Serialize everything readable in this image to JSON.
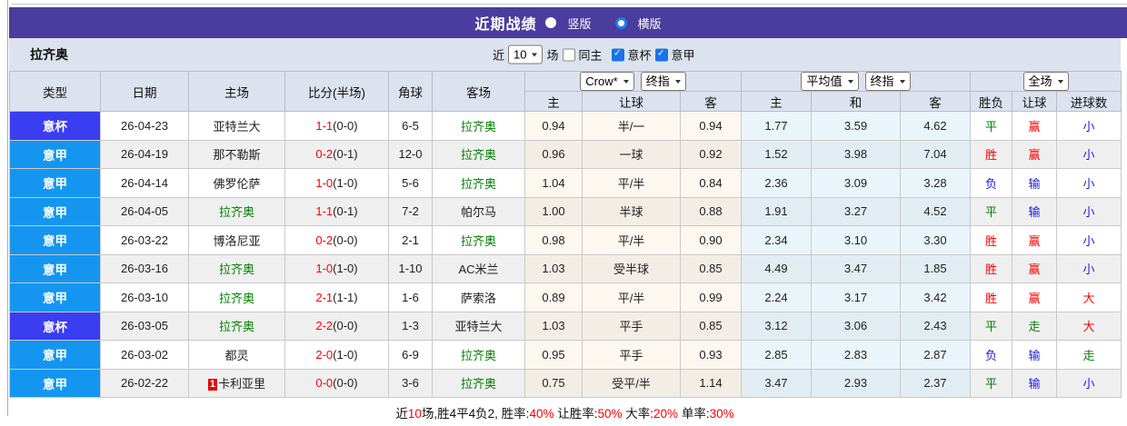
{
  "titlebar": {
    "title": "近期战绩",
    "vertical_label": "竖版",
    "horizontal_label": "横版"
  },
  "controls": {
    "team_name": "拉齐奥",
    "near_label": "近",
    "count_value": "10",
    "unit_label": "场",
    "same_home_label": "同主",
    "cup_filter_label": "意杯",
    "league_filter_label": "意甲",
    "same_home_checked": false,
    "cup_checked": true,
    "league_checked": true
  },
  "table": {
    "selects": {
      "asian_company": "Crow*",
      "asian_kind": "终指",
      "euro_company": "平均值",
      "euro_kind": "终指",
      "scope": "全场"
    },
    "headers": {
      "type": "类型",
      "date": "日期",
      "home": "主场",
      "score": "比分(半场)",
      "corners": "角球",
      "away": "客场",
      "sub": [
        "主",
        "让球",
        "客",
        "主",
        "和",
        "客",
        "胜负",
        "让球",
        "进球数"
      ]
    },
    "rows": [
      {
        "type": "意杯",
        "type_kind": "cup",
        "date": "26-04-23",
        "home": {
          "name": "亚特兰大",
          "lazio": false
        },
        "score": "1-1",
        "half": "(0-0)",
        "corners": "6-5",
        "away": {
          "name": "拉齐奥",
          "lazio": true
        },
        "asian": [
          "0.94",
          "半/一",
          "0.94"
        ],
        "euro": [
          "1.77",
          "3.59",
          "4.62"
        ],
        "result": {
          "t": "平",
          "c": "green"
        },
        "handicap": {
          "t": "赢",
          "c": "red"
        },
        "goals": {
          "t": "小",
          "c": "blue"
        }
      },
      {
        "type": "意甲",
        "type_kind": "league",
        "date": "26-04-19",
        "home": {
          "name": "那不勒斯",
          "lazio": false
        },
        "score": "0-2",
        "half": "(0-1)",
        "corners": "12-0",
        "away": {
          "name": "拉齐奥",
          "lazio": true
        },
        "asian": [
          "0.96",
          "一球",
          "0.92"
        ],
        "euro": [
          "1.52",
          "3.98",
          "7.04"
        ],
        "result": {
          "t": "胜",
          "c": "red"
        },
        "handicap": {
          "t": "赢",
          "c": "red"
        },
        "goals": {
          "t": "小",
          "c": "blue"
        }
      },
      {
        "type": "意甲",
        "type_kind": "league",
        "date": "26-04-14",
        "home": {
          "name": "佛罗伦萨",
          "lazio": false
        },
        "score": "1-0",
        "half": "(1-0)",
        "corners": "5-6",
        "away": {
          "name": "拉齐奥",
          "lazio": true
        },
        "asian": [
          "1.04",
          "平/半",
          "0.84"
        ],
        "euro": [
          "2.36",
          "3.09",
          "3.28"
        ],
        "result": {
          "t": "负",
          "c": "blue"
        },
        "handicap": {
          "t": "输",
          "c": "blue"
        },
        "goals": {
          "t": "小",
          "c": "blue"
        }
      },
      {
        "type": "意甲",
        "type_kind": "league",
        "date": "26-04-05",
        "home": {
          "name": "拉齐奥",
          "lazio": true
        },
        "score": "1-1",
        "half": "(0-1)",
        "corners": "7-2",
        "away": {
          "name": "帕尔马",
          "lazio": false
        },
        "asian": [
          "1.00",
          "半球",
          "0.88"
        ],
        "euro": [
          "1.91",
          "3.27",
          "4.52"
        ],
        "result": {
          "t": "平",
          "c": "green"
        },
        "handicap": {
          "t": "输",
          "c": "blue"
        },
        "goals": {
          "t": "小",
          "c": "blue"
        }
      },
      {
        "type": "意甲",
        "type_kind": "league",
        "date": "26-03-22",
        "home": {
          "name": "博洛尼亚",
          "lazio": false
        },
        "score": "0-2",
        "half": "(0-0)",
        "corners": "2-1",
        "away": {
          "name": "拉齐奥",
          "lazio": true
        },
        "asian": [
          "0.98",
          "平/半",
          "0.90"
        ],
        "euro": [
          "2.34",
          "3.10",
          "3.30"
        ],
        "result": {
          "t": "胜",
          "c": "red"
        },
        "handicap": {
          "t": "赢",
          "c": "red"
        },
        "goals": {
          "t": "小",
          "c": "blue"
        }
      },
      {
        "type": "意甲",
        "type_kind": "league",
        "date": "26-03-16",
        "home": {
          "name": "拉齐奥",
          "lazio": true
        },
        "score": "1-0",
        "half": "(1-0)",
        "corners": "1-10",
        "away": {
          "name": "AC米兰",
          "lazio": false
        },
        "asian": [
          "1.03",
          "受半球",
          "0.85"
        ],
        "euro": [
          "4.49",
          "3.47",
          "1.85"
        ],
        "result": {
          "t": "胜",
          "c": "red"
        },
        "handicap": {
          "t": "赢",
          "c": "red"
        },
        "goals": {
          "t": "小",
          "c": "blue"
        }
      },
      {
        "type": "意甲",
        "type_kind": "league",
        "date": "26-03-10",
        "home": {
          "name": "拉齐奥",
          "lazio": true
        },
        "score": "2-1",
        "half": "(1-1)",
        "corners": "1-6",
        "away": {
          "name": "萨索洛",
          "lazio": false
        },
        "asian": [
          "0.89",
          "平/半",
          "0.99"
        ],
        "euro": [
          "2.24",
          "3.17",
          "3.42"
        ],
        "result": {
          "t": "胜",
          "c": "red"
        },
        "handicap": {
          "t": "赢",
          "c": "red"
        },
        "goals": {
          "t": "大",
          "c": "red"
        }
      },
      {
        "type": "意杯",
        "type_kind": "cup",
        "date": "26-03-05",
        "home": {
          "name": "拉齐奥",
          "lazio": true
        },
        "score": "2-2",
        "half": "(0-0)",
        "corners": "1-3",
        "away": {
          "name": "亚特兰大",
          "lazio": false
        },
        "asian": [
          "1.03",
          "平手",
          "0.85"
        ],
        "euro": [
          "3.12",
          "3.06",
          "2.43"
        ],
        "result": {
          "t": "平",
          "c": "green"
        },
        "handicap": {
          "t": "走",
          "c": "green"
        },
        "goals": {
          "t": "大",
          "c": "red"
        }
      },
      {
        "type": "意甲",
        "type_kind": "league",
        "date": "26-03-02",
        "home": {
          "name": "都灵",
          "lazio": false
        },
        "score": "2-0",
        "half": "(1-0)",
        "corners": "6-9",
        "away": {
          "name": "拉齐奥",
          "lazio": true
        },
        "asian": [
          "0.95",
          "平手",
          "0.93"
        ],
        "euro": [
          "2.85",
          "2.83",
          "2.87"
        ],
        "result": {
          "t": "负",
          "c": "blue"
        },
        "handicap": {
          "t": "输",
          "c": "blue"
        },
        "goals": {
          "t": "走",
          "c": "green"
        }
      },
      {
        "type": "意甲",
        "type_kind": "league",
        "date": "26-02-22",
        "home": {
          "name": "卡利亚里",
          "lazio": false,
          "red_card": "1"
        },
        "score": "0-0",
        "half": "(0-0)",
        "corners": "3-6",
        "away": {
          "name": "拉齐奥",
          "lazio": true
        },
        "asian": [
          "0.75",
          "受平/半",
          "1.14"
        ],
        "euro": [
          "3.47",
          "2.93",
          "2.37"
        ],
        "result": {
          "t": "平",
          "c": "green"
        },
        "handicap": {
          "t": "输",
          "c": "blue"
        },
        "goals": {
          "t": "小",
          "c": "blue"
        }
      }
    ]
  },
  "footer": {
    "parts": [
      {
        "text": "近",
        "red": false
      },
      {
        "text": "10",
        "red": true
      },
      {
        "text": "场,胜4平4负2, 胜率:",
        "red": false
      },
      {
        "text": "40%",
        "red": true
      },
      {
        "text": " 让胜率:",
        "red": false
      },
      {
        "text": "50%",
        "red": true
      },
      {
        "text": " 大率:",
        "red": false
      },
      {
        "text": "20%",
        "red": true
      },
      {
        "text": " 单率:",
        "red": false
      },
      {
        "text": "30%",
        "red": true
      }
    ]
  },
  "colors": {
    "titlebar_bg": "#4b3d9e",
    "cup_badge": "#3a3ef0",
    "league_badge": "#1496f0",
    "red": "#ff0000",
    "green": "#008000",
    "blue": "#1a1ae6"
  }
}
